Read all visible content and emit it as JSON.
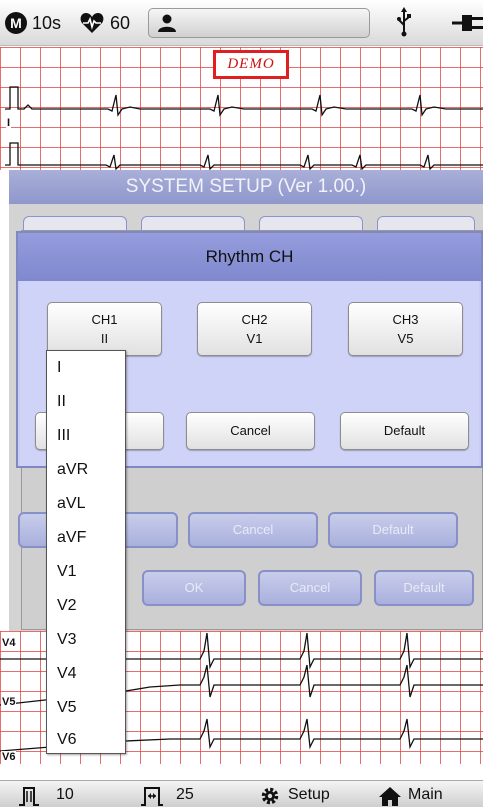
{
  "status_bar": {
    "mode_badge": "M",
    "duration": "10s",
    "heart_rate": "60",
    "icons": [
      "mode-icon",
      "heart-rate-icon",
      "patient-icon",
      "usb-icon",
      "power-plug-icon"
    ]
  },
  "ecg_top": {
    "demo_label": "DEMO",
    "lead_labels": [
      "I"
    ]
  },
  "ecg_bottom": {
    "lead_labels": [
      "V4",
      "V5",
      "V6"
    ]
  },
  "system_setup": {
    "title": "SYSTEM SETUP (Ver 1.00.)",
    "background_buttons": [
      "OK",
      "Cancel",
      "Default",
      "OK",
      "Cancel",
      "Default"
    ]
  },
  "dialog": {
    "title": "Rhythm CH",
    "channels": [
      {
        "name": "CH1",
        "lead": "II"
      },
      {
        "name": "CH2",
        "lead": "V1"
      },
      {
        "name": "CH3",
        "lead": "V5"
      }
    ],
    "buttons": {
      "ok": "OK",
      "cancel": "Cancel",
      "default": "Default"
    }
  },
  "dropdown": {
    "options": [
      "I",
      "II",
      "III",
      "aVR",
      "aVL",
      "aVF",
      "V1",
      "V2",
      "V3",
      "V4",
      "V5",
      "V6"
    ]
  },
  "toolbar": {
    "speed": "10",
    "gain": "25",
    "setup": "Setup",
    "main": "Main",
    "icons": [
      "speed-icon",
      "gain-icon",
      "gear-icon",
      "home-icon"
    ]
  },
  "colors": {
    "grid": "#e13c3c",
    "dialog_header": "#8088cf",
    "dialog_body": "#cfd3f7",
    "demo_border": "#e02020"
  }
}
